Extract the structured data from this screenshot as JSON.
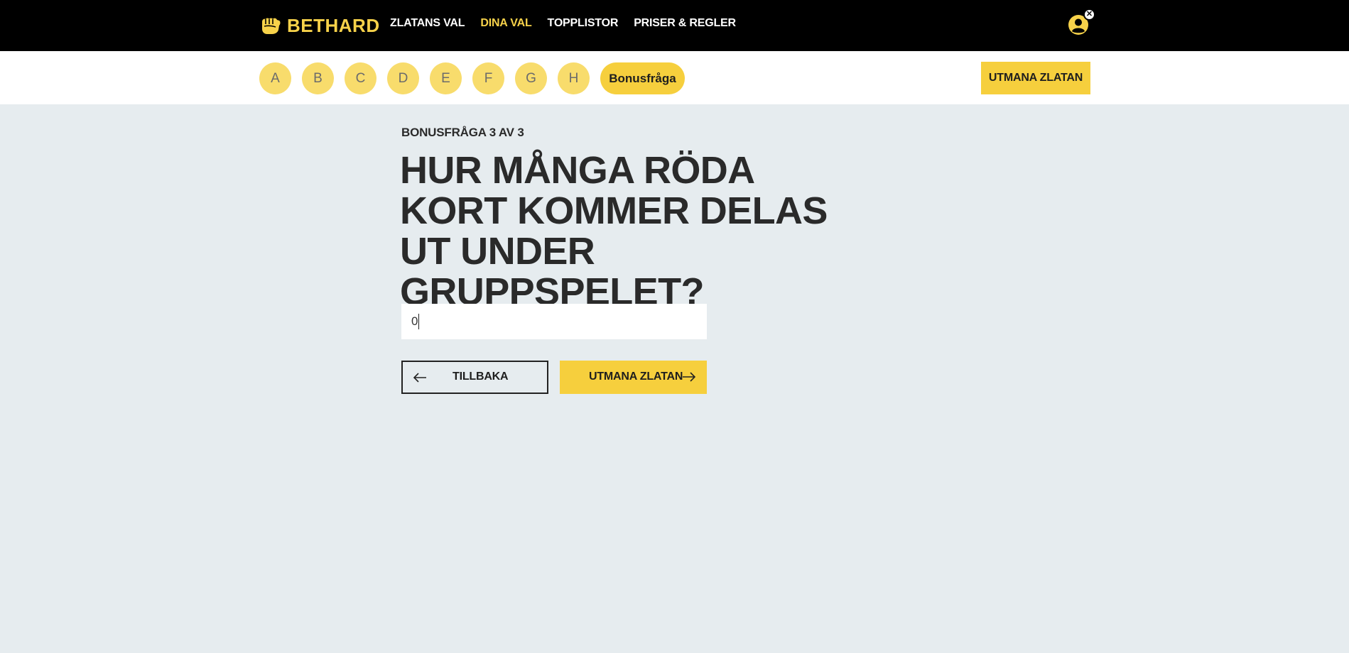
{
  "header": {
    "brand": "BETHARD",
    "logo_icon": "fist-icon",
    "nav": [
      {
        "label": "ZLATANS VAL",
        "active": false
      },
      {
        "label": "DINA VAL",
        "active": true
      },
      {
        "label": "TOPPLISTOR",
        "active": false
      },
      {
        "label": "PRISER & REGLER",
        "active": false
      }
    ],
    "user_icon": "user-icon",
    "close_badge": "✕"
  },
  "groups": {
    "items": [
      "A",
      "B",
      "C",
      "D",
      "E",
      "F",
      "G",
      "H"
    ],
    "bonus_label": "Bonusfråga",
    "cta_label": "UTMANA ZLATAN"
  },
  "question": {
    "kicker": "BONUSFRÅGA 3 AV 3",
    "title": "HUR MÅNGA RÖDA KORT KOMMER DELAS UT UNDER GRUPPSPELET?",
    "answer_value": "0",
    "back_label": "TILLBAKA",
    "next_label": "UTMANA ZLATAN"
  },
  "colors": {
    "accent": "#f6cf3d",
    "accent_light": "#f8dc6c",
    "page_bg": "#e6ecef",
    "topbar_bg": "#000000"
  }
}
